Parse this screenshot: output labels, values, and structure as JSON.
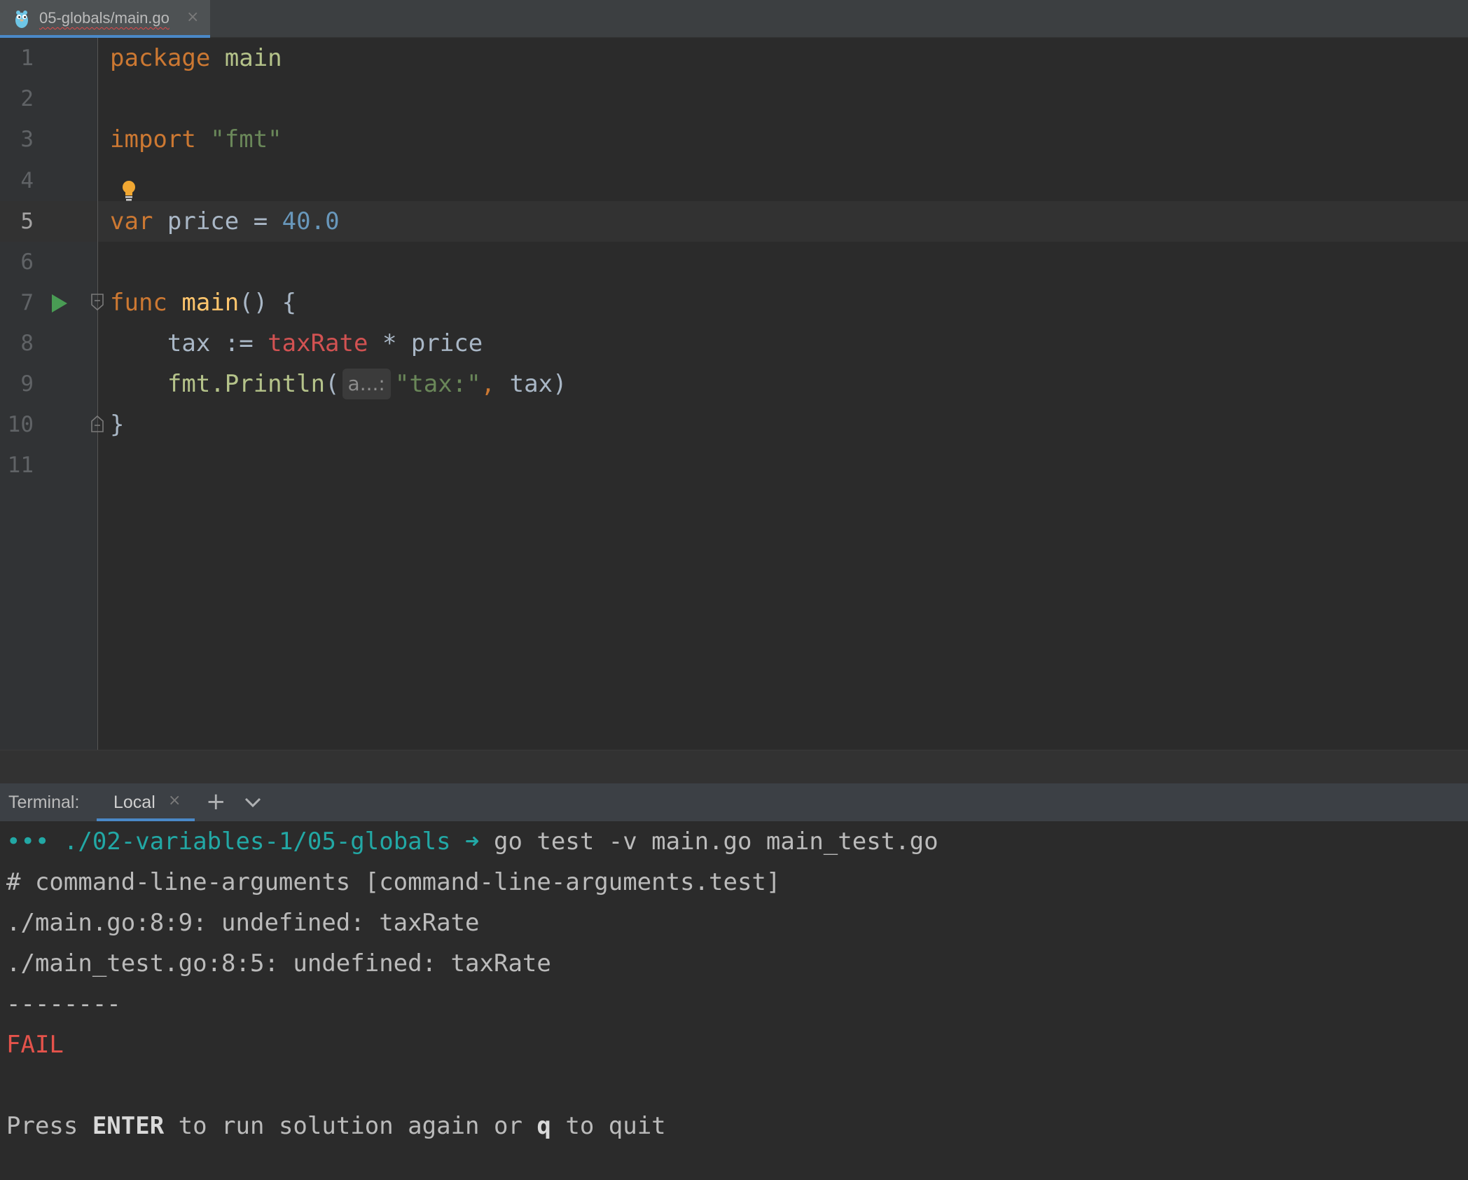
{
  "tab": {
    "icon": "gopher-icon",
    "label": "05-globals/main.go",
    "close": "×"
  },
  "editor": {
    "current_line": 5,
    "line_numbers": [
      "1",
      "2",
      "3",
      "4",
      "5",
      "6",
      "7",
      "8",
      "9",
      "10",
      "11"
    ],
    "code": {
      "l1_kw": "package",
      "l1_name": " main",
      "l3_kw": "import",
      "l3_str": " \"fmt\"",
      "l5_kw": "var",
      "l5_rest": " price = ",
      "l5_num": "40.0",
      "l7_kw": "func",
      "l7_fn": " main",
      "l7_rest": "() {",
      "l8_a": "    tax := ",
      "l8_err": "taxRate",
      "l8_b": " * price",
      "l9_pkg": "    fmt.",
      "l9_meth": "Println",
      "l9_paren": "(",
      "l9_hint": "a...:",
      "l9_str": "\"tax:\"",
      "l9_comma": ",",
      "l9_rest": " tax)",
      "l10": "}"
    },
    "icons": [
      "run-icon",
      "fold-icon",
      "bulb-icon"
    ]
  },
  "terminal": {
    "label": "Terminal:",
    "tab_label": "Local",
    "tab_close": "×",
    "add": "+",
    "prompt_dots": "•••",
    "prompt_path": " ./02-variables-1/05-globals",
    "prompt_arrow": " ➜",
    "command": " go test -v main.go main_test.go",
    "lines": [
      "# command-line-arguments [command-line-arguments.test]",
      "./main.go:8:9: undefined: taxRate",
      "./main_test.go:8:5: undefined: taxRate",
      "--------"
    ],
    "fail": "FAIL",
    "press_a": "Press ",
    "press_enter": "ENTER",
    "press_b": " to run solution again or ",
    "press_q": "q",
    "press_c": " to quit"
  },
  "colors": {
    "keyword": "#cc7832",
    "string": "#6a8759",
    "number": "#6897bb",
    "error": "#d25252",
    "accent": "#4a88c7",
    "fail": "#e5534b"
  }
}
